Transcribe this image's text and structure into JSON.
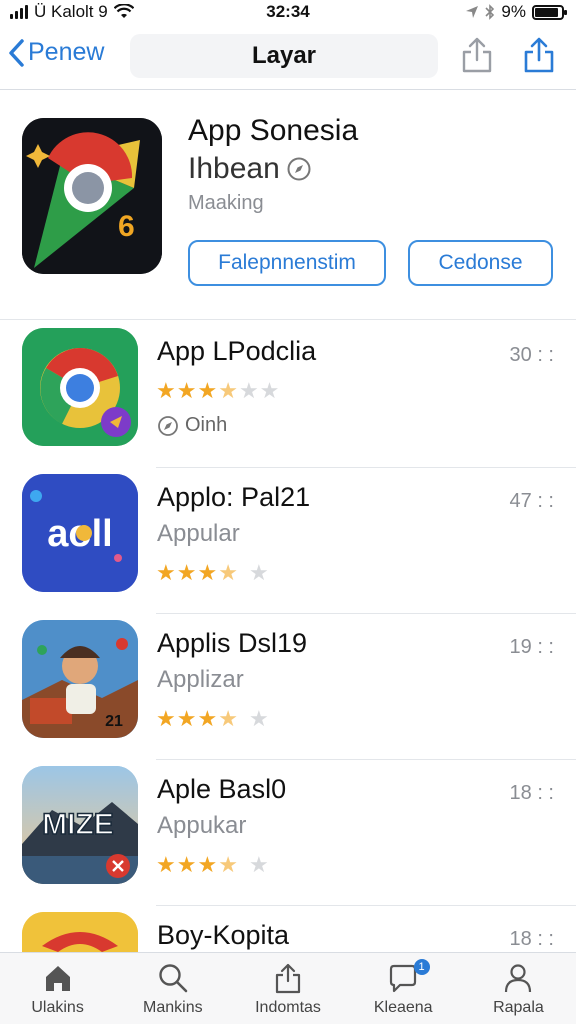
{
  "status_bar": {
    "carrier": "Ü Kalolt 9",
    "time": "32:34",
    "battery": "9%",
    "battery_level": 0.9
  },
  "nav": {
    "back_label": "Penew",
    "title": "Layar"
  },
  "featured": {
    "title": "App Sonesia",
    "subtitle": "Ihbean",
    "meta": "Maaking",
    "primary_button": "Falepnnenstim",
    "secondary_button": "Cedonse"
  },
  "apps": [
    {
      "title": "App LPodclia",
      "subtitle": "",
      "extra": "Oinh",
      "rating": 3.5,
      "time": "30 : :"
    },
    {
      "title": "Applo: Pal21",
      "subtitle": "Appular",
      "extra": "",
      "rating": 3.5,
      "time": "47 : :"
    },
    {
      "title": "Applis Dsl19",
      "subtitle": "Applizar",
      "extra": "",
      "rating": 3.5,
      "time": "19 : :"
    },
    {
      "title": "Aple Basl0",
      "subtitle": "Appukar",
      "extra": "",
      "rating": 3.5,
      "time": "18 : :"
    },
    {
      "title": "Boy-Kopita",
      "subtitle": "",
      "extra": "",
      "rating": 0,
      "time": "18 : :"
    }
  ],
  "icon_text": {
    "app2": "aoll",
    "app3_sign": "21",
    "app4": "MIZE"
  },
  "tabs": [
    {
      "label": "Ulakins",
      "icon": "home-icon"
    },
    {
      "label": "Mankins",
      "icon": "search-icon"
    },
    {
      "label": "Indomtas",
      "icon": "share-icon"
    },
    {
      "label": "Kleaena",
      "icon": "chat-icon",
      "badge": "1"
    },
    {
      "label": "Rapala",
      "icon": "person-icon"
    }
  ],
  "colors": {
    "accent": "#2a7bd6",
    "star": "#f2a623",
    "star_off": "#d7d9dc"
  }
}
